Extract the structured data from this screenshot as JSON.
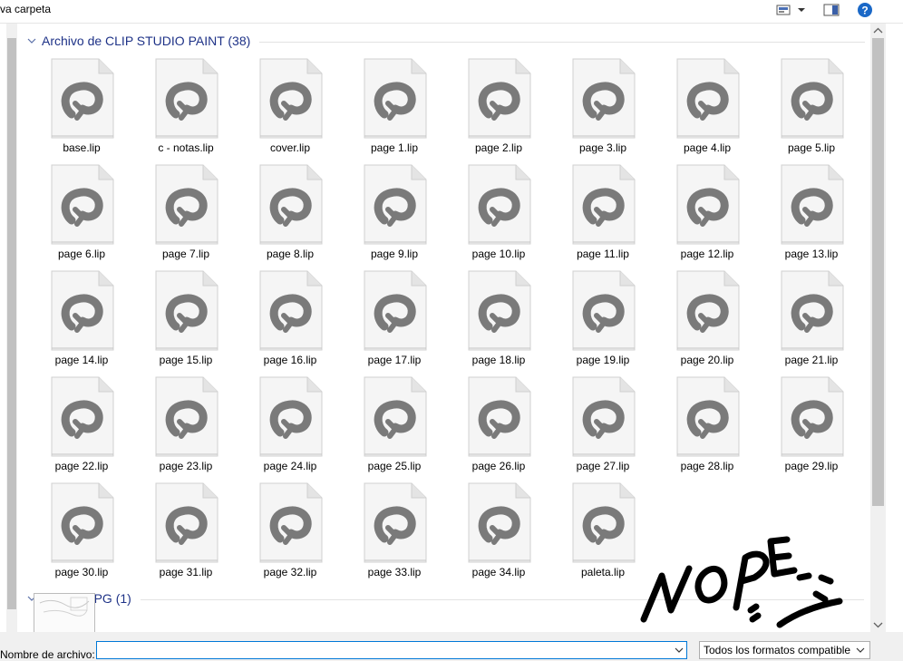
{
  "toolbar": {
    "new_folder_label": "va carpeta",
    "view_icon": "view-options-icon",
    "preview_icon": "preview-pane-icon",
    "help_label": "?"
  },
  "groups": [
    {
      "title": "Archivo de CLIP STUDIO PAINT (38)"
    },
    {
      "title": "Archivo JPG (1)"
    }
  ],
  "files": [
    "base.lip",
    "c - notas.lip",
    "cover.lip",
    "page 1.lip",
    "page 2.lip",
    "page 3.lip",
    "page 4.lip",
    "page 5.lip",
    "page 6.lip",
    "page 7.lip",
    "page 8.lip",
    "page 9.lip",
    "page 10.lip",
    "page 11.lip",
    "page 12.lip",
    "page 13.lip",
    "page 14.lip",
    "page 15.lip",
    "page 16.lip",
    "page 17.lip",
    "page 18.lip",
    "page 19.lip",
    "page 20.lip",
    "page 21.lip",
    "page 22.lip",
    "page 23.lip",
    "page 24.lip",
    "page 25.lip",
    "page 26.lip",
    "page 27.lip",
    "page 28.lip",
    "page 29.lip",
    "page 30.lip",
    "page 31.lip",
    "page 32.lip",
    "page 33.lip",
    "page 34.lip",
    "paleta.lip"
  ],
  "file_icon": "clip-studio-file-icon",
  "footer": {
    "filename_label": "Nombre de archivo:",
    "filename_value": "",
    "filter_value": "Todos los formatos compatible"
  },
  "annotation": {
    "handwritten_text": "NOPE :("
  },
  "colors": {
    "group_header": "#1e3287",
    "icon_gray": "#7a7a7a",
    "focus_border": "#0078d7",
    "help_blue": "#1a68c7"
  }
}
